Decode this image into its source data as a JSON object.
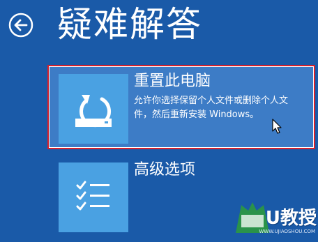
{
  "header": {
    "title": "疑难解答",
    "back_icon": "back-arrow-icon"
  },
  "options": [
    {
      "title": "重置此电脑",
      "description": "允许你选择保留个人文件或删除个人文件，然后重新安装 Windows。",
      "icon": "reset-pc-icon"
    },
    {
      "title": "高级选项",
      "icon": "checklist-icon"
    }
  ],
  "watermark": {
    "brand": "U教授",
    "url": "WWW.UJIAOSHOU.COM"
  },
  "colors": {
    "background": "#1a5aa8",
    "tile": "#4aa1e2",
    "selected": "#3d7cc6",
    "highlight_border": "#d6202c"
  }
}
